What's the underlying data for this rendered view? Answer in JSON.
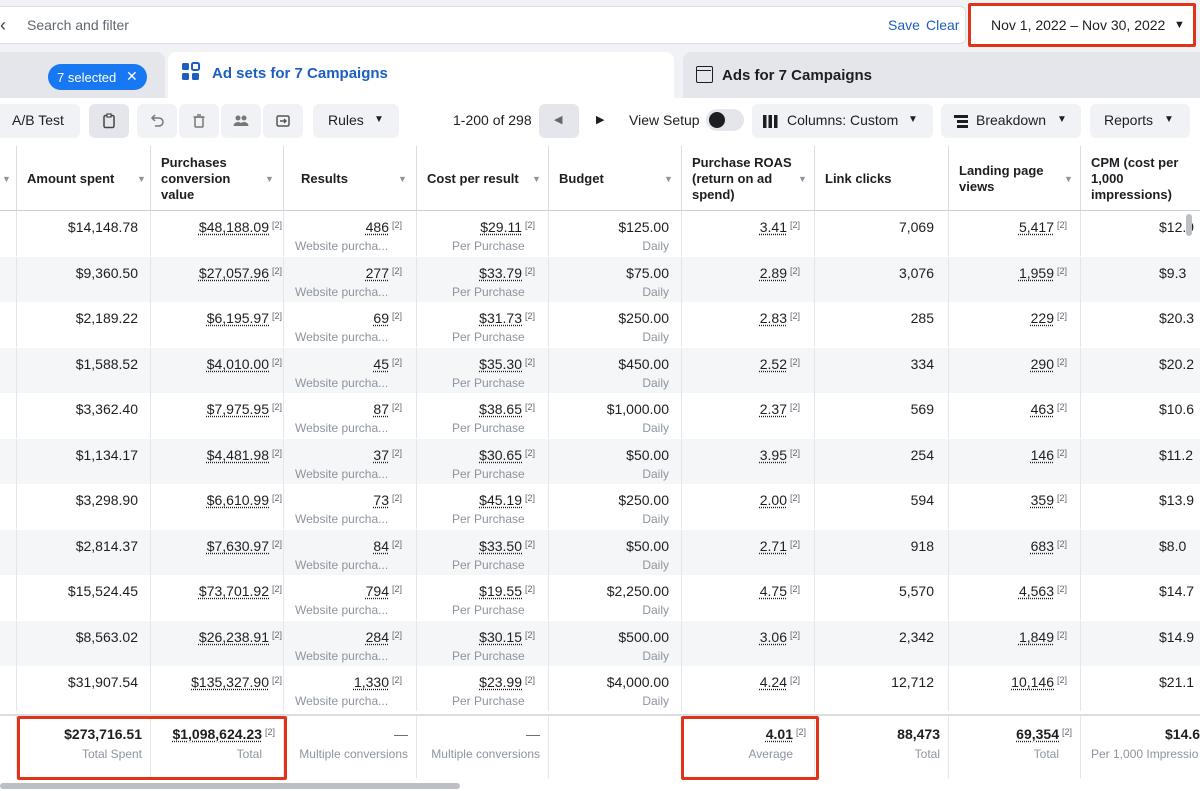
{
  "search": {
    "placeholder": "Search and filter",
    "save_label": "Save",
    "clear_label": "Clear"
  },
  "date_range": {
    "label": "Nov 1, 2022 – Nov 30, 2022"
  },
  "tabs": {
    "selected_label": "7 selected",
    "active": "Ad sets for 7 Campaigns",
    "other": "Ads for 7 Campaigns"
  },
  "toolbar": {
    "ab_test": "A/B Test",
    "rules": "Rules",
    "pager": "1-200 of 298",
    "view_setup": "View Setup",
    "columns": "Columns: Custom",
    "breakdown": "Breakdown",
    "reports": "Reports"
  },
  "headers": {
    "amount_spent": "Amount spent",
    "purchases_value": "Purchases conversion value",
    "results": "Results",
    "cost_per_result": "Cost per result",
    "budget": "Budget",
    "roas": "Purchase ROAS (return on ad spend)",
    "link_clicks": "Link clicks",
    "landing_page_views": "Landing page views",
    "cpm": "CPM (cost per 1,000 impressions)"
  },
  "footnote": "[2]",
  "rows": [
    {
      "spent": "$14,148.78",
      "value": "$48,188.09",
      "results": "486",
      "results_sub": "Website purcha...",
      "cpr": "$29.11",
      "cpr_sub": "Per Purchase",
      "budget": "$125.00",
      "budget_sub": "Daily",
      "roas": "3.41",
      "clicks": "7,069",
      "lpv": "5,417",
      "cpm": "$12.9"
    },
    {
      "spent": "$9,360.50",
      "value": "$27,057.96",
      "results": "277",
      "results_sub": "Website purcha...",
      "cpr": "$33.79",
      "cpr_sub": "Per Purchase",
      "budget": "$75.00",
      "budget_sub": "Daily",
      "roas": "2.89",
      "clicks": "3,076",
      "lpv": "1,959",
      "cpm": "$9.3"
    },
    {
      "spent": "$2,189.22",
      "value": "$6,195.97",
      "results": "69",
      "results_sub": "Website purcha...",
      "cpr": "$31.73",
      "cpr_sub": "Per Purchase",
      "budget": "$250.00",
      "budget_sub": "Daily",
      "roas": "2.83",
      "clicks": "285",
      "lpv": "229",
      "cpm": "$20.3"
    },
    {
      "spent": "$1,588.52",
      "value": "$4,010.00",
      "results": "45",
      "results_sub": "Website purcha...",
      "cpr": "$35.30",
      "cpr_sub": "Per Purchase",
      "budget": "$450.00",
      "budget_sub": "Daily",
      "roas": "2.52",
      "clicks": "334",
      "lpv": "290",
      "cpm": "$20.2"
    },
    {
      "spent": "$3,362.40",
      "value": "$7,975.95",
      "results": "87",
      "results_sub": "Website purcha...",
      "cpr": "$38.65",
      "cpr_sub": "Per Purchase",
      "budget": "$1,000.00",
      "budget_sub": "Daily",
      "roas": "2.37",
      "clicks": "569",
      "lpv": "463",
      "cpm": "$10.6"
    },
    {
      "spent": "$1,134.17",
      "value": "$4,481.98",
      "results": "37",
      "results_sub": "Website purcha...",
      "cpr": "$30.65",
      "cpr_sub": "Per Purchase",
      "budget": "$50.00",
      "budget_sub": "Daily",
      "roas": "3.95",
      "clicks": "254",
      "lpv": "146",
      "cpm": "$11.2"
    },
    {
      "spent": "$3,298.90",
      "value": "$6,610.99",
      "results": "73",
      "results_sub": "Website purcha...",
      "cpr": "$45.19",
      "cpr_sub": "Per Purchase",
      "budget": "$250.00",
      "budget_sub": "Daily",
      "roas": "2.00",
      "clicks": "594",
      "lpv": "359",
      "cpm": "$13.9"
    },
    {
      "spent": "$2,814.37",
      "value": "$7,630.97",
      "results": "84",
      "results_sub": "Website purcha...",
      "cpr": "$33.50",
      "cpr_sub": "Per Purchase",
      "budget": "$50.00",
      "budget_sub": "Daily",
      "roas": "2.71",
      "clicks": "918",
      "lpv": "683",
      "cpm": "$8.0"
    },
    {
      "spent": "$15,524.45",
      "value": "$73,701.92",
      "results": "794",
      "results_sub": "Website purcha...",
      "cpr": "$19.55",
      "cpr_sub": "Per Purchase",
      "budget": "$2,250.00",
      "budget_sub": "Daily",
      "roas": "4.75",
      "clicks": "5,570",
      "lpv": "4,563",
      "cpm": "$14.7"
    },
    {
      "spent": "$8,563.02",
      "value": "$26,238.91",
      "results": "284",
      "results_sub": "Website purcha...",
      "cpr": "$30.15",
      "cpr_sub": "Per Purchase",
      "budget": "$500.00",
      "budget_sub": "Daily",
      "roas": "3.06",
      "clicks": "2,342",
      "lpv": "1,849",
      "cpm": "$14.9"
    },
    {
      "spent": "$31,907.54",
      "value": "$135,327.90",
      "results": "1,330",
      "results_sub": "Website purcha...",
      "cpr": "$23.99",
      "cpr_sub": "Per Purchase",
      "budget": "$4,000.00",
      "budget_sub": "Daily",
      "roas": "4.24",
      "clicks": "12,712",
      "lpv": "10,146",
      "cpm": "$21.1"
    }
  ],
  "totals": {
    "spent": "$273,716.51",
    "spent_label": "Total Spent",
    "value": "$1,098,624.23",
    "value_label": "Total",
    "results": "—",
    "results_label": "Multiple conversions",
    "cpr": "—",
    "cpr_label": "Multiple conversions",
    "roas": "4.01",
    "roas_label": "Average",
    "clicks": "88,473",
    "clicks_label": "Total",
    "lpv": "69,354",
    "lpv_label": "Total",
    "cpm": "$14.6",
    "cpm_label": "Per 1,000 Impressio"
  },
  "colors": {
    "accent": "#1877f2",
    "highlight": "#e0341a",
    "link": "#1d5fbf"
  }
}
